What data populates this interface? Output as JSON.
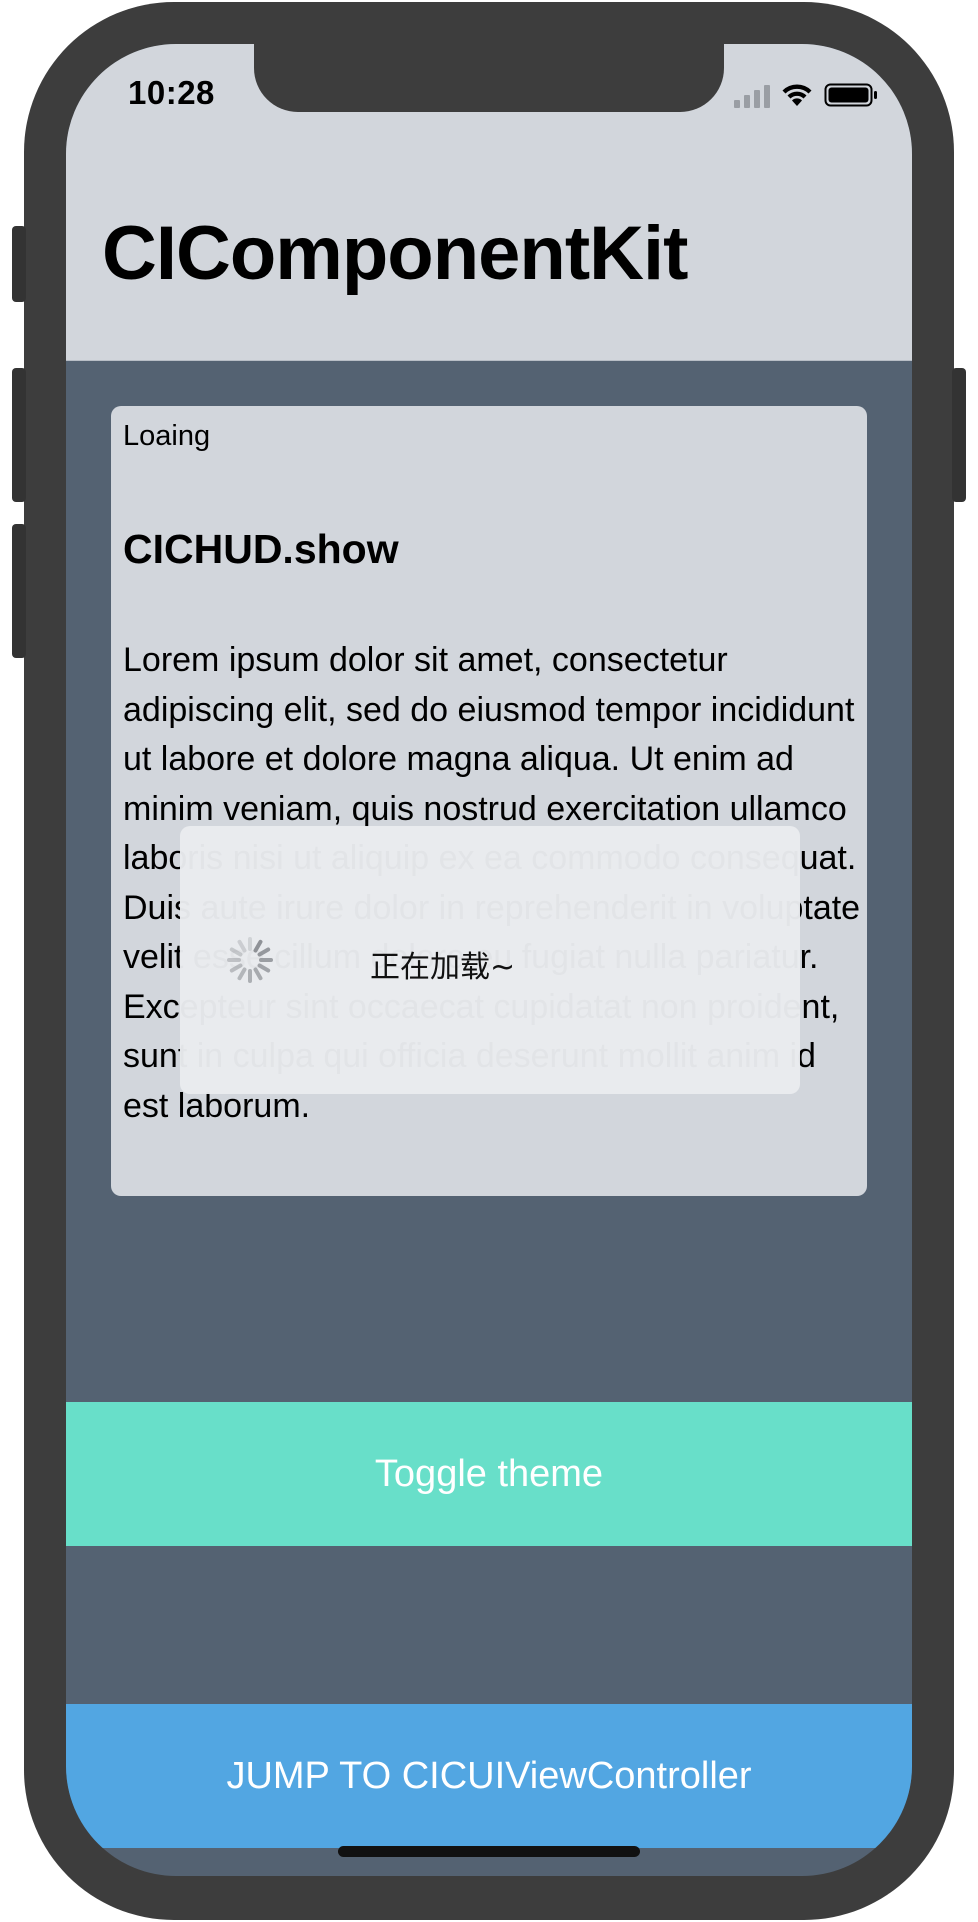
{
  "status_bar": {
    "time": "10:28",
    "icons": [
      "cellular-signal-icon",
      "wifi-icon",
      "battery-icon"
    ]
  },
  "nav": {
    "title": "CIComponentKit"
  },
  "card": {
    "label": "Loaing",
    "title": "CICHUD.show",
    "body": "Lorem ipsum dolor sit amet, consectetur adipiscing elit, sed do eiusmod tempor incididunt ut labore et dolore magna aliqua. Ut enim ad minim veniam, quis nostrud exercitation ullamco laboris nisi ut aliquip ex ea commodo consequat. Duis aute irure dolor in reprehenderit in voluptate velit esse cillum dolore eu fugiat nulla pariatur. Excepteur sint occaecat cupidatat non proident, sunt in culpa qui officia deserunt mollit anim id est laborum."
  },
  "hud": {
    "message": "正在加载~",
    "icon": "activity-spinner-icon"
  },
  "buttons": {
    "toggle_theme": "Toggle theme",
    "jump": "JUMP TO CICUIViewController"
  },
  "colors": {
    "nav_background": "#d2d6dc",
    "content_background": "#546272",
    "toggle_button": "#68dfc9",
    "jump_button": "#52a6e2",
    "phone_frame": "#3d3d3d"
  }
}
